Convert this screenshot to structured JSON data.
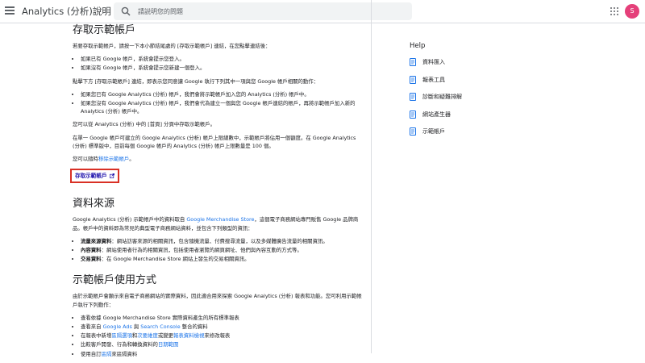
{
  "header": {
    "app_title": "Analytics (分析)說明",
    "search_placeholder": "請説明您的問題",
    "avatar_letter": "S",
    "icons": [
      "hamburger-icon",
      "search-icon",
      "apps-icon"
    ]
  },
  "section1": {
    "title": "存取示範帳戶",
    "intro": "若要存取示範帳戶，請按一下本小節結尾處的 [存取示範帳戶] 連結，在您點擊連結後：",
    "list1": [
      "如果已有 Google 帳戶，系統會提示您登入。",
      "如果沒有 Google 帳戶，系統會提示您新建一個登入。"
    ],
    "para2": "點擊下方 [存取示範帳戶] 連結，即表示您同意讓 Google 執行下列其中一項與您 Google 帳戶相關的動作：",
    "list2": [
      "如果您已有 Google Analytics (分析) 帳戶，我們會將示範帳戶加入您的 Analytics (分析) 帳戶中。",
      "如果您沒有 Google Analytics (分析) 帳戶，我們會代為建立一個與您 Google 帳戶連結的帳戶，再將示範帳戶加入新的 Analytics (分析) 帳戶中。"
    ],
    "para3": "您可以從 Analytics (分析) 中的 [首頁] 分頁中存取示範帳戶。",
    "para4": "在單一 Google 帳戶可建立的 Google Analytics (分析) 帳戶上限總數中，示範帳戶將佔用一個額度。在 Google Analytics (分析) 標準版中，目前每個 Google 帳戶的 Analytics (分析) 帳戶上限數量是 100 個。",
    "para5_prefix": "您可以隨時",
    "para5_link": "移除示範帳戶",
    "para5_suffix": "。",
    "cta": "存取示範帳戶"
  },
  "section2": {
    "title": "資料來源",
    "intro_prefix": "Google Analytics (分析) 示範帳戶中的資料取自 ",
    "intro_link": "Google Merchandise Store",
    "intro_suffix": "，這個電子商務網站專門販售 Google 品牌商品。帳戶中的資料即為常見的典型電子商務網站資料，並包含下列類型的資訊：",
    "items": [
      {
        "bold": "流量來源資料",
        "text": "：網站訪客來源的相關資訊，包含隨機流量、付費搜尋流量，以及多媒體廣告流量的相關資訊。"
      },
      {
        "bold": "內容資料",
        "text": "：網站使用者行為的相關資訊，包括使用者瀏覽的網頁網址、他們與內容互動的方式等。"
      },
      {
        "bold": "交易資料",
        "text": "：在 Google Merchandise Store 網站上發生的交易相關資訊。"
      }
    ]
  },
  "section3": {
    "title": "示範帳戶使用方式",
    "intro": "由於示範帳戶會顯示來自電子商務網站的實際資料，因此適合用來探索 Google Analytics (分析) 報表和功能。您可利用示範帳戶執行下列動作：",
    "item1": "查看依據 Google Merchandise Store 實際資料產生的所有標準報表",
    "item2_prefix": "查看來自 ",
    "item2_link1": "Google Ads",
    "item2_mid": " 與 ",
    "item2_link2": "Search Console",
    "item2_suffix": " 整合的資料",
    "item3_prefix": "在報表中新增",
    "item3_link1": "區隔選項",
    "item3_mid1": "和",
    "item3_link2": "次要維度",
    "item3_mid2": "或變更",
    "item3_link3": "報表資料檢視",
    "item3_suffix": "來修改報表",
    "item4_prefix": "比較客戶開發、行為和轉換資料的",
    "item4_link": "日期範圍",
    "item5_prefix": "使用自訂",
    "item5_link": "區隔",
    "item5_suffix": "來區隔資料"
  },
  "help": {
    "title": "Help",
    "items": [
      "資料匯入",
      "報表工具",
      "診斷和疑難排解",
      "網站產生器",
      "示範帳戶"
    ]
  }
}
